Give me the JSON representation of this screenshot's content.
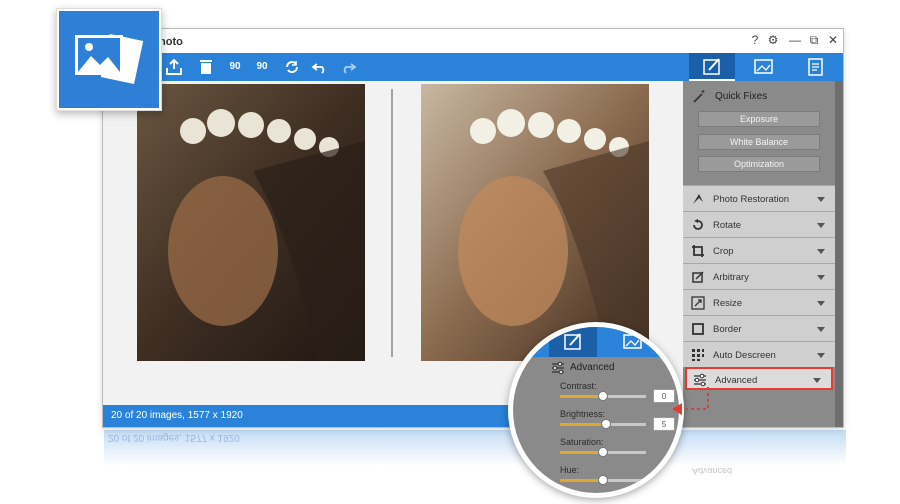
{
  "app": {
    "title": "hoto"
  },
  "window_controls": [
    "?",
    "⚙",
    "—",
    "⧉",
    "✕"
  ],
  "toolbar": {
    "rotate_left_label": "90",
    "rotate_right_label": "90"
  },
  "status": {
    "text": "20 of 20 images, 1577 x 1920"
  },
  "side_panel": {
    "quick_fixes_title": "Quick Fixes",
    "quick_fix_buttons": [
      "Exposure",
      "White Balance",
      "Optimization"
    ],
    "sections": [
      {
        "label": "Photo Restoration",
        "icon": "restoration-icon"
      },
      {
        "label": "Rotate",
        "icon": "rotate-icon"
      },
      {
        "label": "Crop",
        "icon": "crop-icon"
      },
      {
        "label": "Arbitrary",
        "icon": "arbitrary-icon"
      },
      {
        "label": "Resize",
        "icon": "resize-icon"
      },
      {
        "label": "Border",
        "icon": "border-icon"
      },
      {
        "label": "Auto Descreen",
        "icon": "descreen-icon"
      },
      {
        "label": "Advanced",
        "icon": "sliders-icon",
        "highlighted": true
      }
    ]
  },
  "magnifier": {
    "title": "Advanced",
    "sliders": [
      {
        "label": "Contrast:",
        "value": "0",
        "level": 0.5
      },
      {
        "label": "Brightness:",
        "value": "5",
        "level": 0.53
      },
      {
        "label": "Saturation:",
        "value": "",
        "level": 0.5
      },
      {
        "label": "Hue:",
        "value": "",
        "level": 0.5
      }
    ]
  },
  "reflection": {
    "status_text": "20 of 20 images, 1577 x 1920",
    "panel_text": "Advanced"
  },
  "colors": {
    "accent": "#2b82d9",
    "highlight": "#e53a36",
    "panel": "#8a8a8a",
    "slider_fill": "#e0a82e"
  }
}
